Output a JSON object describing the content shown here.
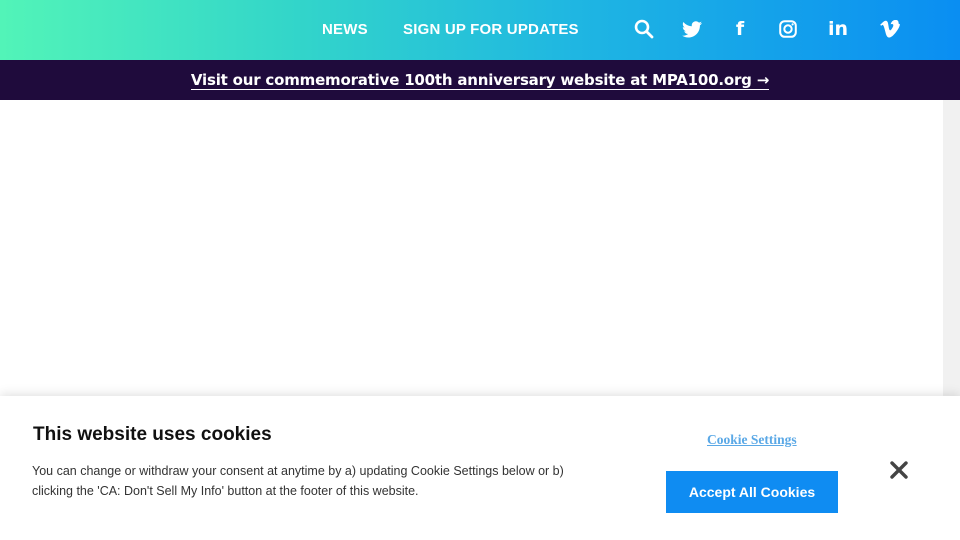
{
  "nav": {
    "links": [
      "NEWS",
      "SIGN UP FOR UPDATES"
    ],
    "icons": [
      "search-icon",
      "twitter-icon",
      "facebook-icon",
      "instagram-icon",
      "linkedin-icon",
      "vimeo-icon"
    ],
    "linkedin_text": "in",
    "facebook_text": "f"
  },
  "banner": {
    "text": "Visit our commemorative 100th anniversary website at MPA100.org →"
  },
  "cookie": {
    "title": "This website uses cookies",
    "body": "You can change or withdraw your consent at anytime by a) updating Cookie Settings below or b) clicking the 'CA: Don't Sell My Info' button at the footer of this website.",
    "settings_label": "Cookie Settings",
    "accept_label": "Accept All Cookies"
  },
  "colors": {
    "gradient_start": "#52f4b8",
    "gradient_end": "#0a8ef2",
    "banner_bg": "#1f0b3c",
    "accept_button": "#0f8cf2",
    "settings_link": "#5aa8e6"
  }
}
